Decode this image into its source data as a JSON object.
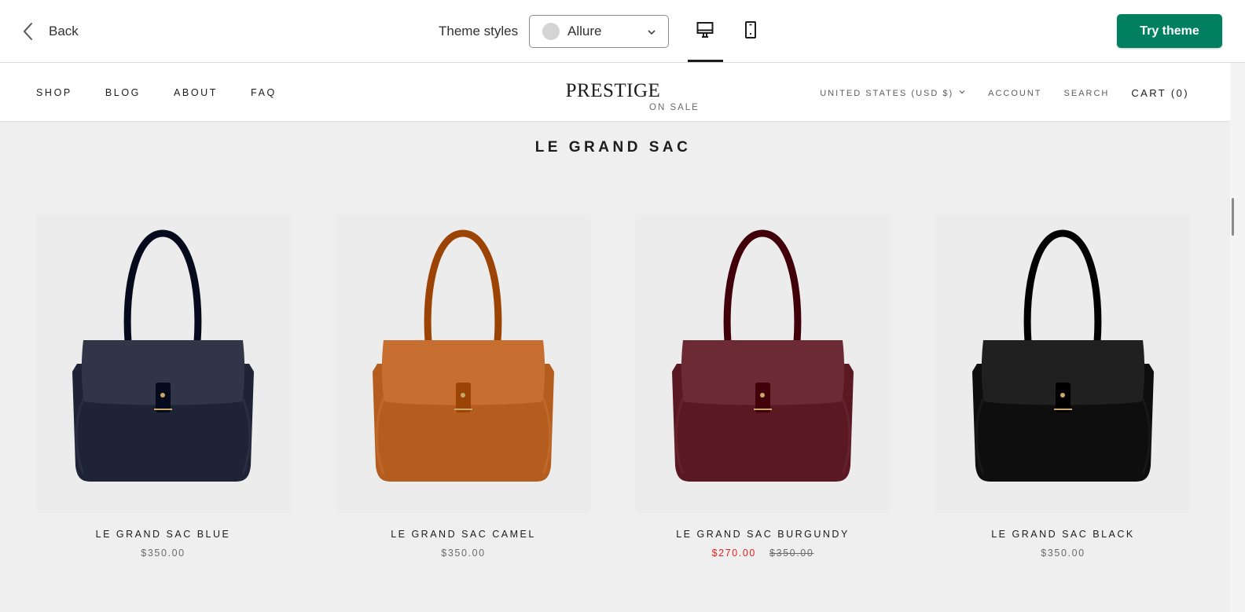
{
  "editor": {
    "back_label": "Back",
    "theme_styles_label": "Theme styles",
    "theme_style_value": "Allure",
    "try_theme_label": "Try theme",
    "accent_color": "#008060"
  },
  "store": {
    "logo": "PRESTIGE",
    "nav": [
      "SHOP",
      "BLOG",
      "ABOUT",
      "FAQ"
    ],
    "currency": "UNITED STATES (USD $)",
    "account": "ACCOUNT",
    "search": "SEARCH",
    "cart": "CART (0)"
  },
  "collection": {
    "title": "LE GRAND SAC",
    "sale_badge": "ON SALE",
    "products": [
      {
        "name": "LE GRAND SAC BLUE",
        "price": "$350.00",
        "color": "#1e2336"
      },
      {
        "name": "LE GRAND SAC CAMEL",
        "price": "$350.00",
        "color": "#b55d1e"
      },
      {
        "name": "LE GRAND SAC BURGUNDY",
        "sale_price": "$270.00",
        "compare_price": "$350.00",
        "color": "#5a1822"
      },
      {
        "name": "LE GRAND SAC BLACK",
        "price": "$350.00",
        "color": "#0e0e0e"
      }
    ]
  }
}
